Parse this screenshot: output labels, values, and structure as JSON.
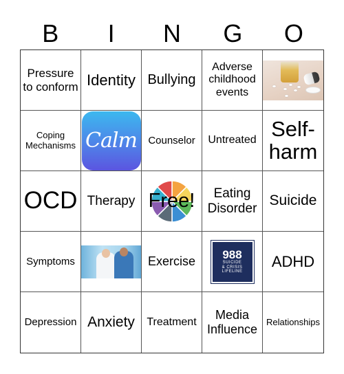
{
  "header": {
    "letters": [
      "B",
      "I",
      "N",
      "G",
      "O"
    ]
  },
  "board": {
    "rows": [
      [
        {
          "type": "text",
          "text": "Pressure to conform"
        },
        {
          "type": "text",
          "text": "Identity"
        },
        {
          "type": "text",
          "text": "Bullying"
        },
        {
          "type": "text",
          "text": "Adverse childhood events"
        },
        {
          "type": "image",
          "image": "alcohol-and-pills-photo"
        }
      ],
      [
        {
          "type": "text",
          "text": "Coping Mechanisms"
        },
        {
          "type": "image",
          "image": "calm-app-logo",
          "logo_text": "Calm"
        },
        {
          "type": "text",
          "text": "Counselor"
        },
        {
          "type": "text",
          "text": "Untreated"
        },
        {
          "type": "text",
          "text": "Self-harm"
        }
      ],
      [
        {
          "type": "text",
          "text": "OCD"
        },
        {
          "type": "text",
          "text": "Therapy"
        },
        {
          "type": "free",
          "text": "Free!"
        },
        {
          "type": "text",
          "text": "Eating Disorder"
        },
        {
          "type": "text",
          "text": "Suicide"
        }
      ],
      [
        {
          "type": "text",
          "text": "Symptoms"
        },
        {
          "type": "image",
          "image": "doctors-photo"
        },
        {
          "type": "text",
          "text": "Exercise"
        },
        {
          "type": "image",
          "image": "988-lifeline-logo",
          "logo_number": "988",
          "logo_lines": [
            "SUICIDE",
            "& CRISIS",
            "LIFELINE"
          ]
        },
        {
          "type": "text",
          "text": "ADHD"
        }
      ],
      [
        {
          "type": "text",
          "text": "Depression"
        },
        {
          "type": "text",
          "text": "Anxiety"
        },
        {
          "type": "text",
          "text": "Treatment"
        },
        {
          "type": "text",
          "text": "Media Influence"
        },
        {
          "type": "text",
          "text": "Relationships"
        }
      ]
    ]
  },
  "free_wheel_colors": [
    "#f4a340",
    "#f6d55c",
    "#5db85c",
    "#3b8fd4",
    "#5b6b78",
    "#8a5bb0",
    "#36b0cf",
    "#e04a4a"
  ]
}
